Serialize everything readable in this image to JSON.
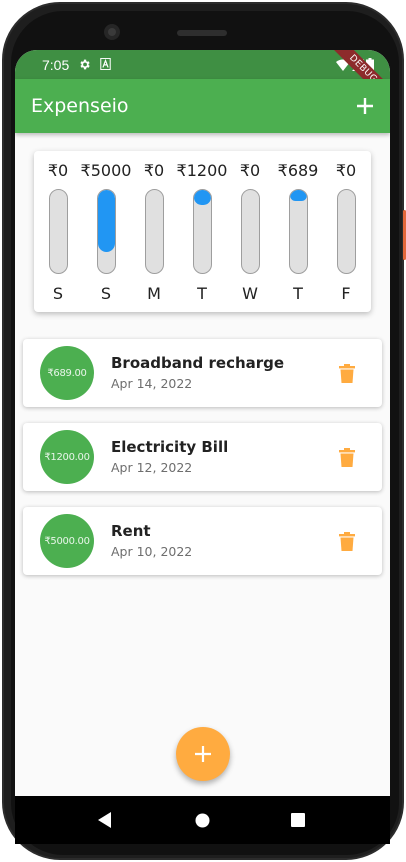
{
  "status_bar": {
    "time": "7:05",
    "debug_label": "DEBUG"
  },
  "app_bar": {
    "title": "Expenseio",
    "add_icon": "plus-icon"
  },
  "chart_data": {
    "type": "bar",
    "categories": [
      "S",
      "S",
      "M",
      "T",
      "W",
      "T",
      "F"
    ],
    "amount_labels": [
      "₹0",
      "₹5000",
      "₹0",
      "₹1200",
      "₹0",
      "₹689",
      "₹0"
    ],
    "values": [
      0,
      5000,
      0,
      1200,
      0,
      689,
      0
    ],
    "share_of_total": [
      0,
      0.726,
      0,
      0.174,
      0,
      0.1,
      0
    ],
    "orientation": "vertical",
    "fill_color": "#2196f3",
    "track_color": "#e0e0e0"
  },
  "transactions": [
    {
      "amount": "₹689.00",
      "title": "Broadband recharge",
      "date": "Apr 14, 2022"
    },
    {
      "amount": "₹1200.00",
      "title": "Electricity Bill",
      "date": "Apr 12, 2022"
    },
    {
      "amount": "₹5000.00",
      "title": "Rent",
      "date": "Apr 10, 2022"
    }
  ],
  "colors": {
    "primary": "#4caf50",
    "status_bar": "#3f8f43",
    "accent": "#ffab40",
    "chart_fill": "#2196f3"
  },
  "icons": {
    "delete": "trash-icon",
    "fab": "plus-icon",
    "nav_back": "back-triangle-icon",
    "nav_home": "home-circle-icon",
    "nav_recents": "recents-square-icon"
  }
}
